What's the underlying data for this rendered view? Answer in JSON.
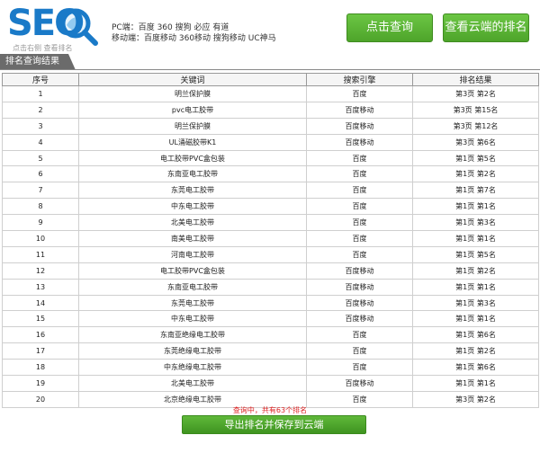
{
  "header": {
    "logo_text": "SEO",
    "logo_tagline": "点击右侧 查看排名",
    "pc_engines": "PC端：百度 360 搜狗 必应 有道",
    "mobile_engines": "移动端：百度移动 360移动 搜狗移动 UC神马",
    "query_button": "点击查询",
    "cloud_button": "查看云端的排名"
  },
  "tab": {
    "label": "排名查询结果"
  },
  "table": {
    "headers": [
      "序号",
      "关键词",
      "搜索引擎",
      "排名结果"
    ],
    "rows": [
      {
        "no": "1",
        "keyword": "明兰保护膜",
        "engine": "百度",
        "rank": "第3页 第2名"
      },
      {
        "no": "2",
        "keyword": "pvc电工胶带",
        "engine": "百度移动",
        "rank": "第3页 第15名"
      },
      {
        "no": "3",
        "keyword": "明兰保护膜",
        "engine": "百度移动",
        "rank": "第3页 第12名"
      },
      {
        "no": "4",
        "keyword": "UL涌磁胶带K1",
        "engine": "百度移动",
        "rank": "第3页 第6名"
      },
      {
        "no": "5",
        "keyword": "电工胶带PVC盒包装",
        "engine": "百度",
        "rank": "第1页 第5名"
      },
      {
        "no": "6",
        "keyword": "东南亚电工胶带",
        "engine": "百度",
        "rank": "第1页 第2名"
      },
      {
        "no": "7",
        "keyword": "东莞电工胶带",
        "engine": "百度",
        "rank": "第1页 第7名"
      },
      {
        "no": "8",
        "keyword": "中东电工胶带",
        "engine": "百度",
        "rank": "第1页 第1名"
      },
      {
        "no": "9",
        "keyword": "北美电工胶带",
        "engine": "百度",
        "rank": "第1页 第3名"
      },
      {
        "no": "10",
        "keyword": "南美电工胶带",
        "engine": "百度",
        "rank": "第1页 第1名"
      },
      {
        "no": "11",
        "keyword": "河南电工胶带",
        "engine": "百度",
        "rank": "第1页 第5名"
      },
      {
        "no": "12",
        "keyword": "电工胶带PVC盒包装",
        "engine": "百度移动",
        "rank": "第1页 第2名"
      },
      {
        "no": "13",
        "keyword": "东南亚电工胶带",
        "engine": "百度移动",
        "rank": "第1页 第1名"
      },
      {
        "no": "14",
        "keyword": "东莞电工胶带",
        "engine": "百度移动",
        "rank": "第1页 第3名"
      },
      {
        "no": "15",
        "keyword": "中东电工胶带",
        "engine": "百度移动",
        "rank": "第1页 第1名"
      },
      {
        "no": "16",
        "keyword": "东南亚绝缘电工胶带",
        "engine": "百度",
        "rank": "第1页 第6名"
      },
      {
        "no": "17",
        "keyword": "东莞绝缘电工胶带",
        "engine": "百度",
        "rank": "第1页 第2名"
      },
      {
        "no": "18",
        "keyword": "中东绝缘电工胶带",
        "engine": "百度",
        "rank": "第1页 第6名"
      },
      {
        "no": "19",
        "keyword": "北美电工胶带",
        "engine": "百度移动",
        "rank": "第1页 第1名"
      },
      {
        "no": "20",
        "keyword": "北京绝缘电工胶带",
        "engine": "百度",
        "rank": "第3页 第2名"
      }
    ]
  },
  "footer": {
    "status": "查询中，共有63个排名",
    "export_button": "导出排名并保存到云端"
  },
  "colors": {
    "brand_blue": "#1a7ac8",
    "button_green": "#4ea42a",
    "status_red": "#d22222",
    "tab_gray": "#6b6b6b"
  }
}
